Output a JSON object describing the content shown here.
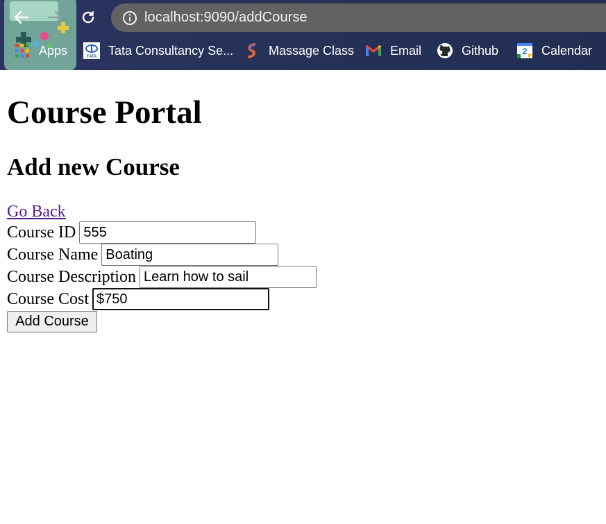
{
  "browser": {
    "url": "localhost:9090/addCourse",
    "bookmarks": [
      {
        "label": "Apps",
        "icon": "apps-grid-icon"
      },
      {
        "label": "Tata Consultancy Se...",
        "icon": "tata-logo-icon"
      },
      {
        "label": "Massage Class",
        "icon": "massage-s-icon"
      },
      {
        "label": "Email",
        "icon": "gmail-icon"
      },
      {
        "label": "Github",
        "icon": "github-icon"
      },
      {
        "label": "Calendar",
        "icon": "calendar-icon"
      }
    ],
    "calendar_day": "2",
    "colors": {
      "chrome_bg": "#2c3561",
      "omnibox_bg": "#626262"
    }
  },
  "page": {
    "title": "Course Portal",
    "subtitle": "Add new Course",
    "back_link": "Go Back",
    "fields": [
      {
        "label": "Course ID",
        "value": "555"
      },
      {
        "label": "Course Name",
        "value": "Boating"
      },
      {
        "label": "Course Description",
        "value": "Learn how to sail"
      },
      {
        "label": "Course Cost",
        "value": "$750"
      }
    ],
    "submit_label": "Add Course",
    "colors": {
      "link_visited": "#551a8b"
    }
  }
}
